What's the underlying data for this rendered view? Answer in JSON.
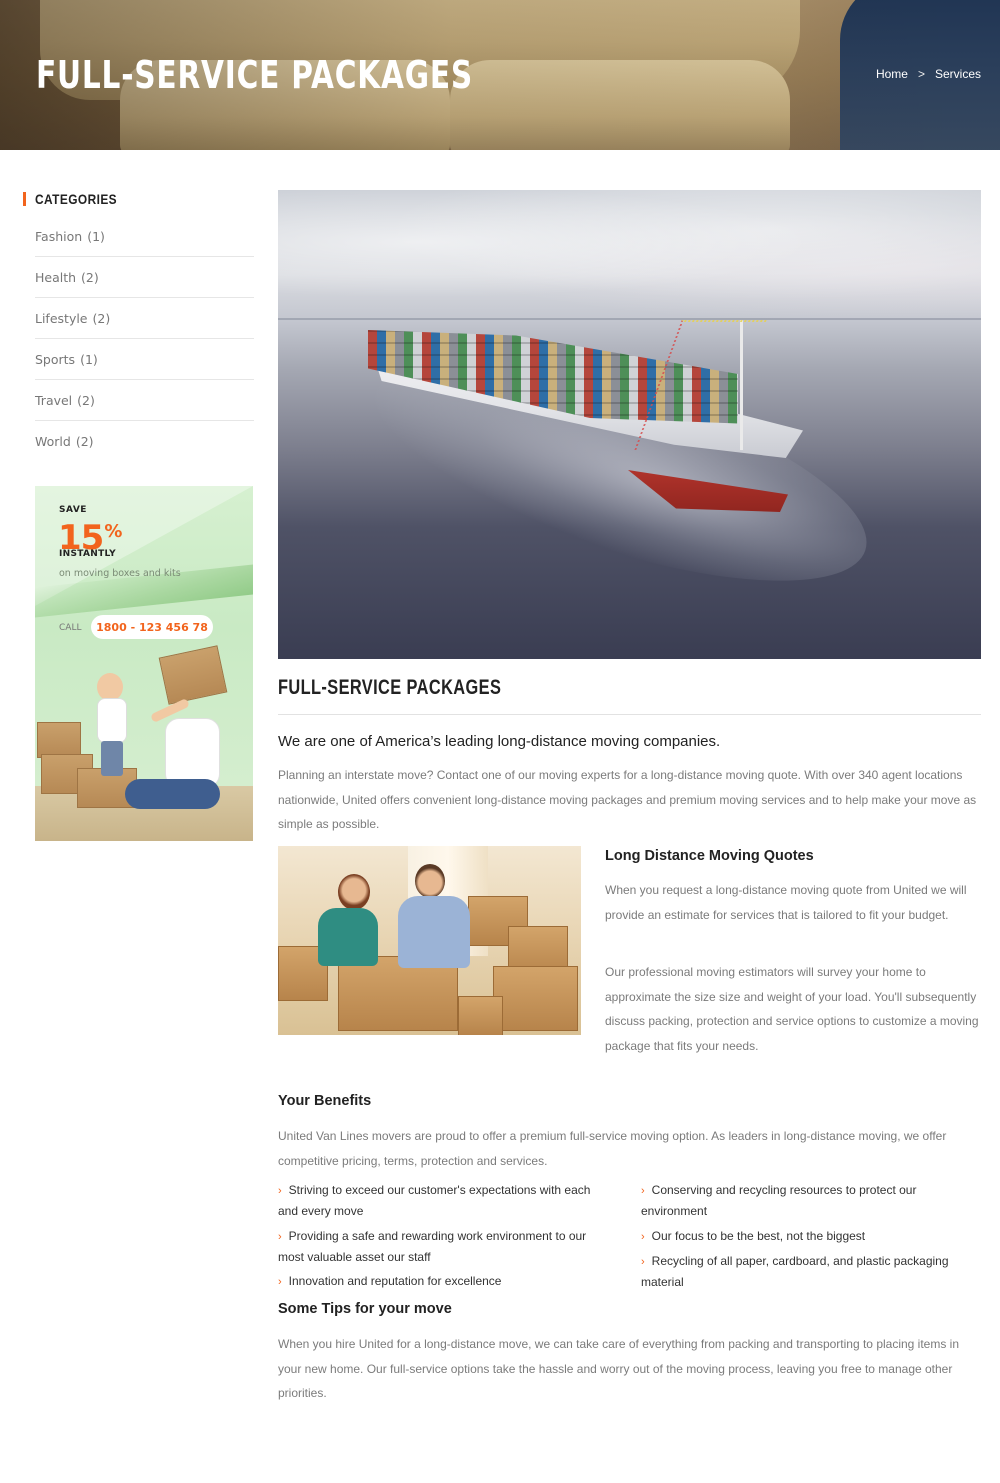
{
  "header": {
    "title": "FULL-SERVICE PACKAGES",
    "breadcrumb": {
      "home": "Home",
      "separator": ">",
      "current": "Services"
    }
  },
  "sidebar": {
    "categories_heading": "CATEGORIES",
    "categories": [
      {
        "label": "Fashion",
        "count": "(1)"
      },
      {
        "label": "Health",
        "count": "(2)"
      },
      {
        "label": "Lifestyle",
        "count": "(2)"
      },
      {
        "label": "Sports",
        "count": "(1)"
      },
      {
        "label": "Travel",
        "count": "(2)"
      },
      {
        "label": "World",
        "count": "(2)"
      }
    ],
    "promo": {
      "save": "SAVE",
      "percent": "15",
      "percent_sign": "%",
      "instantly": "INSTANTLY",
      "subtitle": "on moving boxes and kits",
      "call_label": "CALL",
      "phone": "1800 - 123 456 78",
      "accent_color": "#f2641d"
    }
  },
  "main": {
    "section_title": "FULL-SERVICE PACKAGES",
    "lead": "We are one of America’s leading long-distance moving companies.",
    "intro": "Planning an interstate move? Contact one of our moving experts for a long-distance moving quote. With over 340 agent locations nationwide, United offers convenient long-distance moving packages and premium moving services and to help make your move as simple as possible.",
    "quotes": {
      "heading": "Long Distance Moving Quotes",
      "p1": "When you request a long-distance moving quote from United we will provide an estimate for services that is tailored to fit your budget.",
      "p2": "Our professional moving estimators will survey your home to approximate the size size and weight of your load. You'll subsequently discuss packing, protection and service options to customize a moving package that fits your needs."
    },
    "benefits": {
      "heading": "Your Benefits",
      "intro": "United Van Lines movers are proud to offer a premium full-service moving option. As leaders in long-distance moving, we offer competitive pricing, terms, protection and services.",
      "left": [
        "Striving to exceed our customer's expectations with each and every move",
        "Providing a safe and rewarding work environment to our most valuable asset our staff",
        "Innovation and reputation for excellence"
      ],
      "right": [
        "Conserving and recycling resources to protect our environment",
        "Our focus to be the best, not the biggest",
        "Recycling of all paper, cardboard, and plastic packaging material"
      ],
      "bullet_icon": "chevron-right-icon"
    },
    "tips": {
      "heading": "Some Tips for your move",
      "text": "When you hire United for a long-distance move, we can take care of everything from packing and transporting to placing items in your new home. Our full-service options take the hassle and worry out of the moving process, leaving you free to manage other priorities."
    }
  }
}
